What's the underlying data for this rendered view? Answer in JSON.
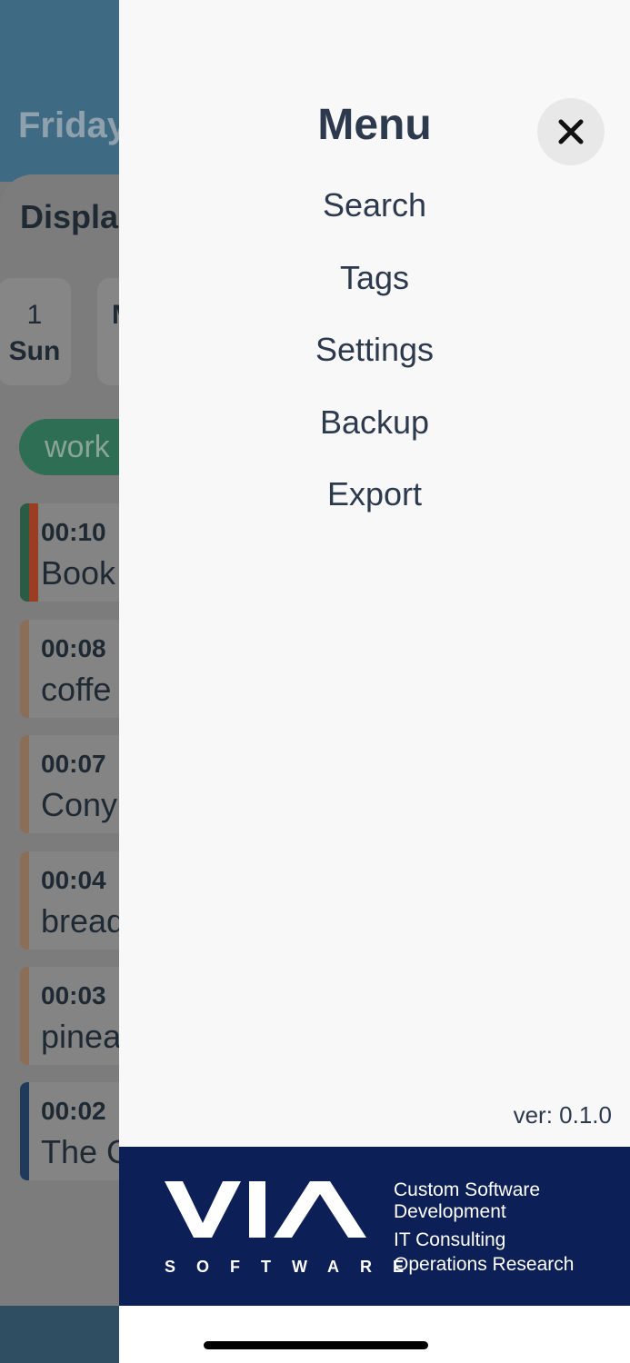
{
  "background": {
    "title": "Friday,",
    "section_title": "Displa",
    "days": [
      {
        "num": "1",
        "dow": "Sun"
      },
      {
        "num": "",
        "dow": "M"
      }
    ],
    "tag": "work",
    "entries": [
      {
        "time": "00:10",
        "name": "Book",
        "colors": [
          "#2a5b44",
          "#9b3d22"
        ]
      },
      {
        "time": "00:08",
        "name": "coffe",
        "colors": [
          "#8a6e58"
        ]
      },
      {
        "time": "00:07",
        "name": "Cony",
        "colors": [
          "#8a6e58"
        ]
      },
      {
        "time": "00:04",
        "name": "bread",
        "colors": [
          "#8a6e58"
        ]
      },
      {
        "time": "00:03",
        "name": "pinea",
        "colors": [
          "#8a6e58"
        ]
      },
      {
        "time": "00:02",
        "name": "The G",
        "colors": [
          "#1f3a5a"
        ]
      }
    ]
  },
  "menu": {
    "title": "Menu",
    "close_icon": "close-icon",
    "items": [
      {
        "label": "Search"
      },
      {
        "label": "Tags"
      },
      {
        "label": "Settings"
      },
      {
        "label": "Backup"
      },
      {
        "label": "Export"
      }
    ],
    "version": "ver: 0.1.0"
  },
  "banner": {
    "logo_text": "VIA",
    "logo_sub": "SOFTWARE",
    "lines": [
      "Custom Software",
      "Development",
      "IT Consulting",
      "Operations Research"
    ],
    "background_color": "#0c1f56"
  }
}
